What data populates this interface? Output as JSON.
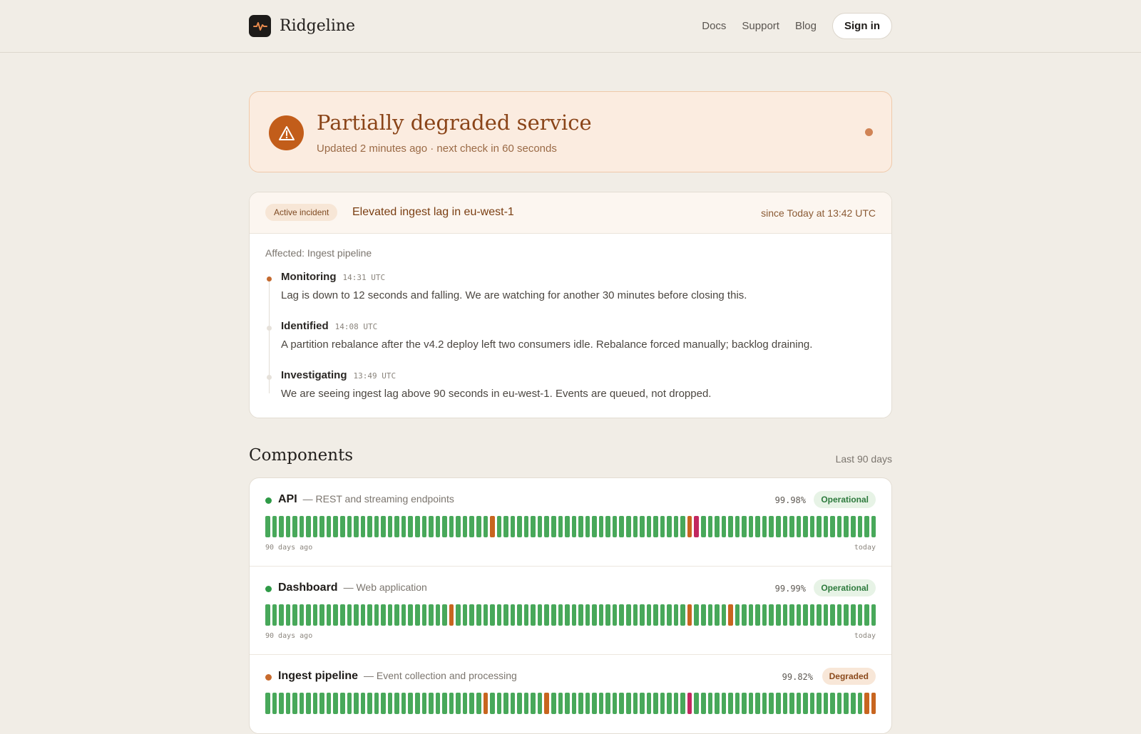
{
  "header": {
    "brand": "Ridgeline",
    "nav": [
      "Docs",
      "Support",
      "Blog"
    ],
    "signin_label": "Sign in"
  },
  "banner": {
    "title": "Partially degraded service",
    "subtitle": "Updated 2 minutes ago · next check in 60 seconds",
    "icon": "warning-triangle-icon",
    "accent": "#c25d1a"
  },
  "incident": {
    "badge": "Active incident",
    "title": "Elevated ingest lag in eu-west-1",
    "since": "since Today at 13:42 UTC",
    "affected": "Affected: Ingest pipeline",
    "updates": [
      {
        "status": "Monitoring",
        "time": "14:31 UTC",
        "text": "Lag is down to 12 seconds and falling. We are watching for another 30 minutes before closing this."
      },
      {
        "status": "Identified",
        "time": "14:08 UTC",
        "text": "A partition rebalance after the v4.2 deploy left two consumers idle. Rebalance forced manually; backlog draining."
      },
      {
        "status": "Investigating",
        "time": "13:49 UTC",
        "text": "We are seeing ingest lag above 90 seconds in eu-west-1. Events are queued, not dropped."
      }
    ]
  },
  "components": {
    "title": "Components",
    "range": "Last 90 days",
    "start_label": "90 days ago",
    "end_label": "today",
    "items": [
      {
        "name": "API",
        "desc": "— REST and streaming endpoints",
        "uptime": "99.98%",
        "status": "Operational",
        "state": "ok",
        "incidents": {
          "33": "o",
          "62": "o",
          "63": "r"
        }
      },
      {
        "name": "Dashboard",
        "desc": "— Web application",
        "uptime": "99.99%",
        "status": "Operational",
        "state": "ok",
        "incidents": {
          "27": "o",
          "62": "o",
          "68": "o"
        }
      },
      {
        "name": "Ingest pipeline",
        "desc": "— Event collection and processing",
        "uptime": "99.82%",
        "status": "Degraded",
        "state": "deg",
        "incidents": {
          "32": "o",
          "41": "o",
          "62": "r",
          "88": "o",
          "89": "o"
        }
      }
    ]
  }
}
